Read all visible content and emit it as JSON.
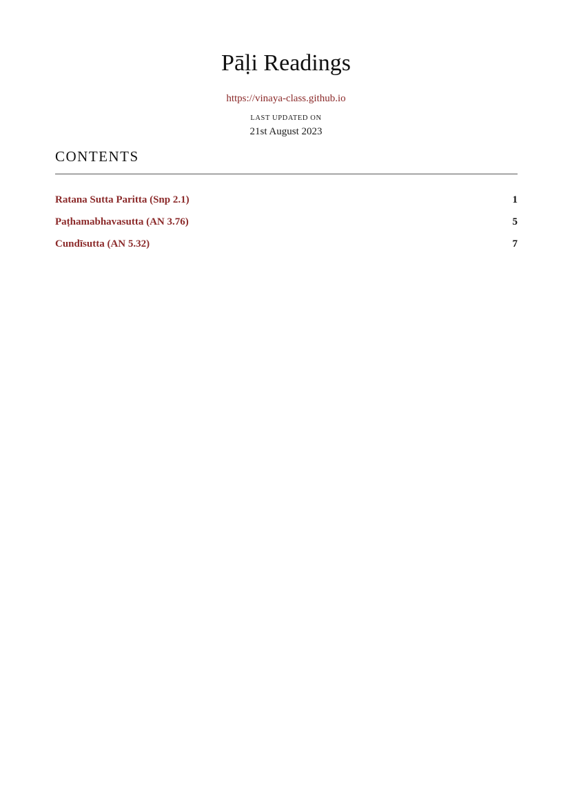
{
  "document": {
    "title": "Pāḷi Readings",
    "url": "https://vinaya-class.github.io",
    "updated_label": "last updated on",
    "updated_date": "21st August 2023"
  },
  "contents": {
    "heading": "Contents",
    "entries": [
      {
        "title": "Ratana Sutta Paritta (Snp 2.1)",
        "page": "1"
      },
      {
        "title": "Paṭhamabhavasutta (AN 3.76)",
        "page": "5"
      },
      {
        "title": "Cundīsutta (AN 5.32)",
        "page": "7"
      }
    ]
  },
  "colors": {
    "link": "#8b2a2a",
    "text": "#1a1a1a"
  }
}
